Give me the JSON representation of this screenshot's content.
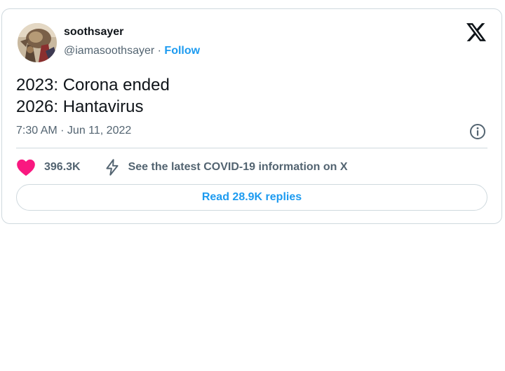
{
  "author": {
    "display_name": "soothsayer",
    "handle": "@iamasoothsayer",
    "separator": "·",
    "follow_label": "Follow"
  },
  "tweet": {
    "lines": [
      "2023: Corona ended",
      "2026: Hantavirus"
    ],
    "timestamp": "7:30 AM · Jun 11, 2022"
  },
  "actions": {
    "like_count": "396.3K",
    "covid_info_label": "See the latest COVID-19 information on X"
  },
  "replies_button_label": "Read 28.9K replies",
  "icons": {
    "brand": "x-logo-icon",
    "info": "info-icon",
    "like": "heart-icon",
    "covid": "lightning-bolt-icon"
  },
  "colors": {
    "accent": "#1d9bf0",
    "heart": "#f91880",
    "text": "#0f1419",
    "secondary_text": "#536471",
    "border": "#cfd9de"
  }
}
